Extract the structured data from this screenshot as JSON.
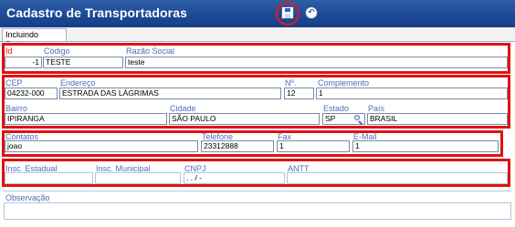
{
  "window": {
    "title": "Cadastro de Transportadoras"
  },
  "toolbar": {
    "save_icon": "floppy-disk-icon",
    "back_icon": "circle-arrow-left-icon"
  },
  "tabs": [
    {
      "label": "Incluindo Registro"
    }
  ],
  "colors": {
    "header": "#1d4a96",
    "label": "#4a6fb8",
    "required": "#e11111",
    "highlight_border": "#e11111"
  },
  "ident": {
    "id_label": "Id",
    "id_value": "-1",
    "codigo_label": "Código",
    "codigo_value": "TESTE",
    "razao_label": "Razão Social",
    "razao_value": "teste"
  },
  "address": {
    "cep_label": "CEP",
    "cep_value": "04232-000",
    "endereco_label": "Endereço",
    "endereco_value": "ESTRADA DAS LÁGRIMAS",
    "numero_label": "Nº.",
    "numero_value": "12",
    "complemento_label": "Complemento",
    "complemento_value": "1",
    "bairro_label": "Bairro",
    "bairro_value": "IPIRANGA",
    "cidade_label": "Cidade",
    "cidade_value": "SÃO PAULO",
    "estado_label": "Estado",
    "estado_value": "SP",
    "pais_label": "País",
    "pais_value": "BRASIL"
  },
  "contact": {
    "contatos_label": "Contatos",
    "contatos_value": "joao",
    "telefone_label": "Telefone",
    "telefone_value": "23312888",
    "fax_label": "Fax",
    "fax_value": "1",
    "email_label": "E-Mail",
    "email_value": "1"
  },
  "fiscal": {
    "insc_estadual_label": "Insc. Estadual",
    "insc_estadual_value": "",
    "insc_municipal_label": "Insc. Municipal",
    "insc_municipal_value": "",
    "cnpj_label": "CNPJ",
    "cnpj_value": " .   .   /    -",
    "antt_label": "ANTT",
    "antt_value": ""
  },
  "notes": {
    "observacao_label": "Observação",
    "observacao_value": ""
  }
}
